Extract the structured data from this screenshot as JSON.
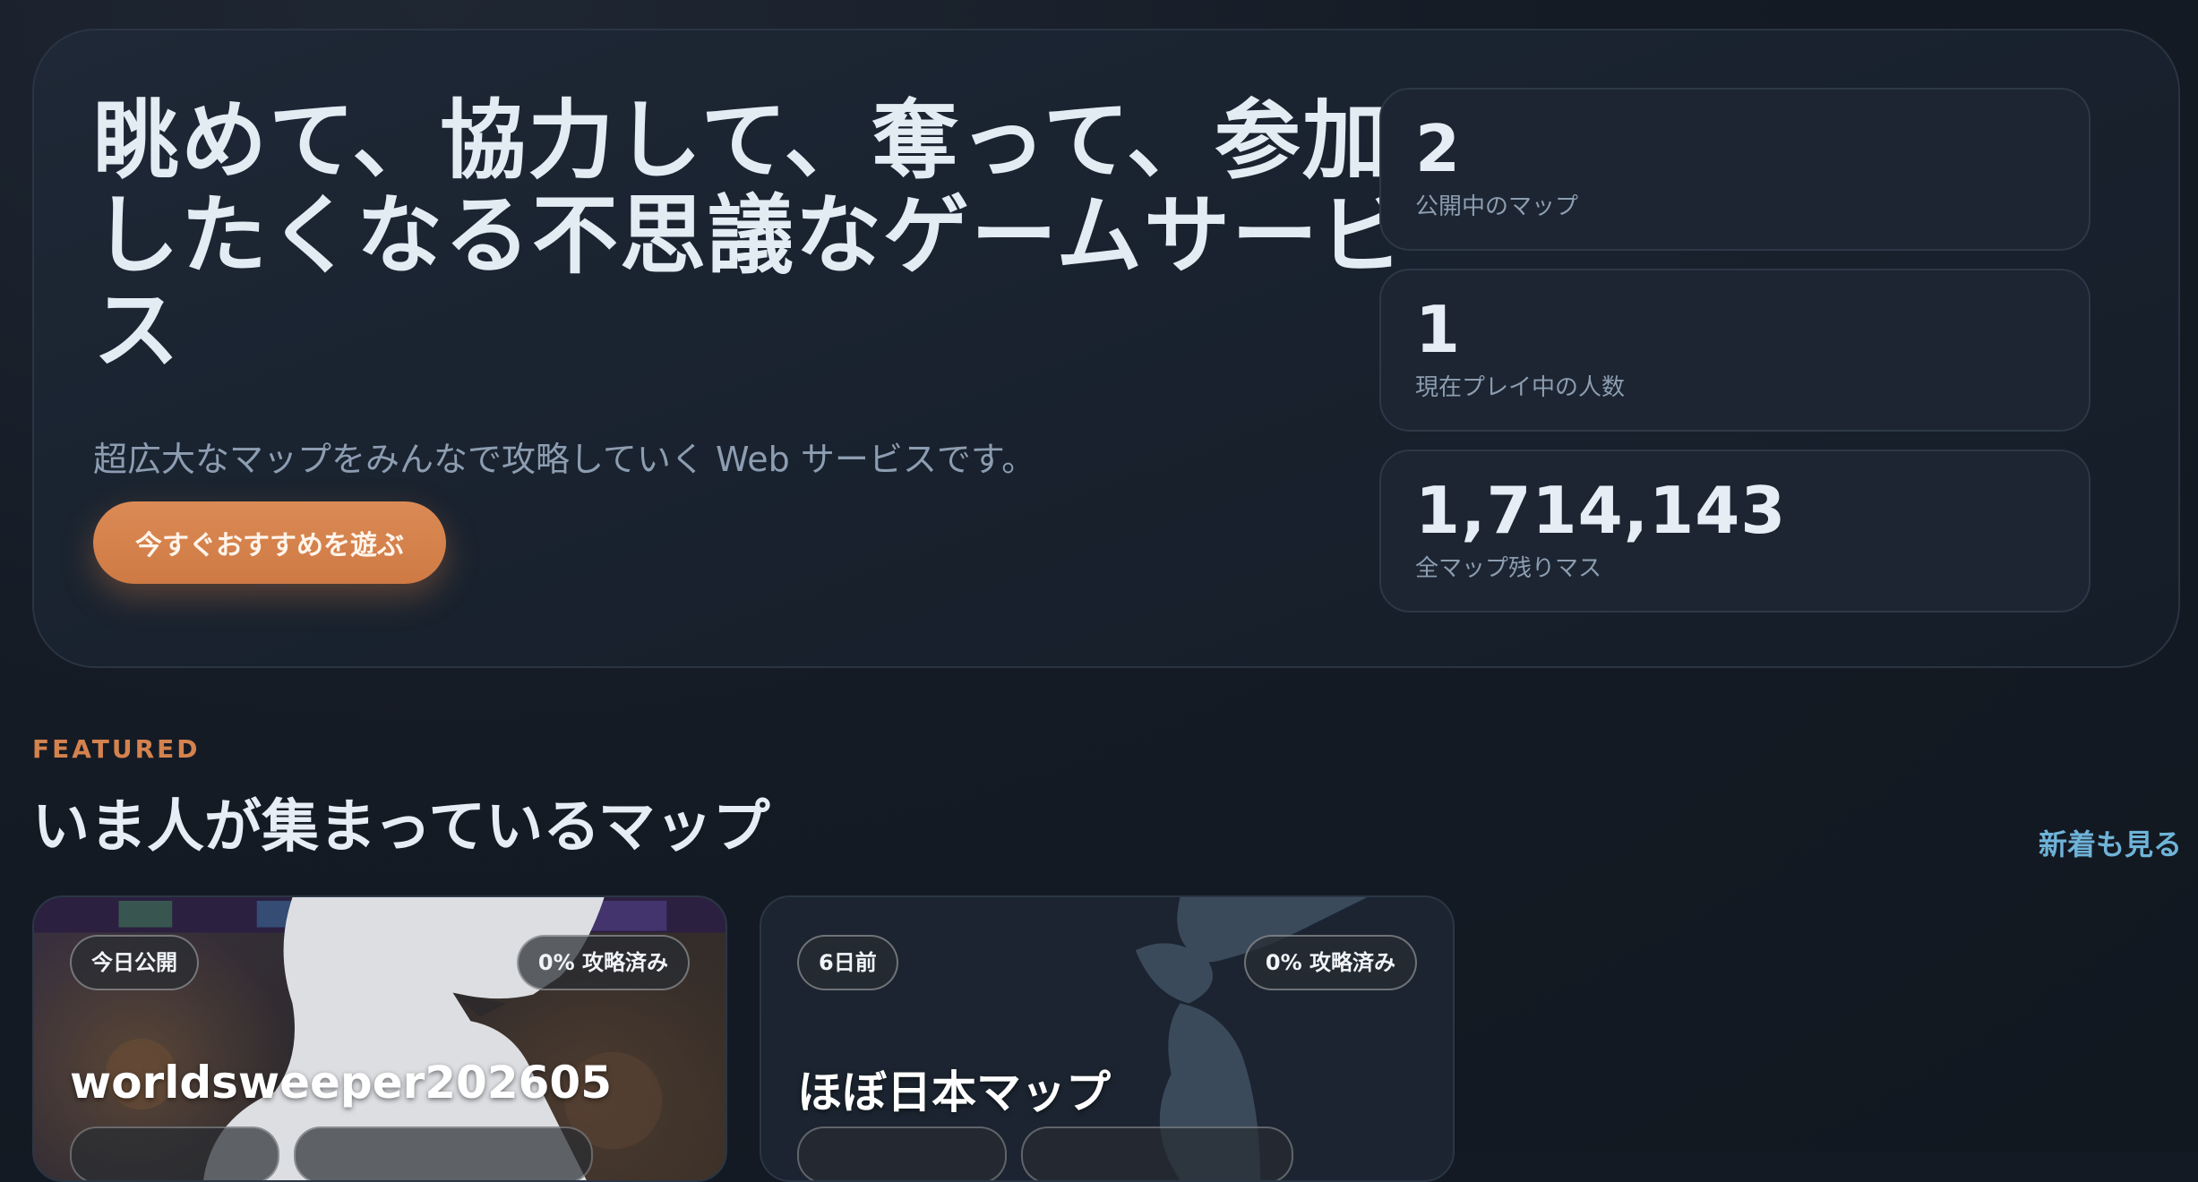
{
  "hero": {
    "title": "眺めて、協力して、奪って、参加したくなる不思議なゲームサービス",
    "subtitle": "超広大なマップをみんなで攻略していく Web サービスです。",
    "cta_label": "今すぐおすすめを遊ぶ"
  },
  "stats": [
    {
      "value": "2",
      "label": "公開中のマップ"
    },
    {
      "value": "1",
      "label": "現在プレイ中の人数"
    },
    {
      "value": "1,714,143",
      "label": "全マップ残りマス"
    }
  ],
  "featured": {
    "eyebrow": "FEATURED",
    "title": "いま人が集まっているマップ",
    "see_new_label": "新着も見る"
  },
  "maps": [
    {
      "published": "今日公開",
      "progress": "0% 攻略済み",
      "title": "worldsweeper202605"
    },
    {
      "published": "6日前",
      "progress": "0% 攻略済み",
      "title": "ほぼ日本マップ"
    }
  ],
  "colors": {
    "accent": "#d4824e",
    "cta": "#cf7a44",
    "link": "#6fb3d8",
    "background": "#141a24"
  }
}
